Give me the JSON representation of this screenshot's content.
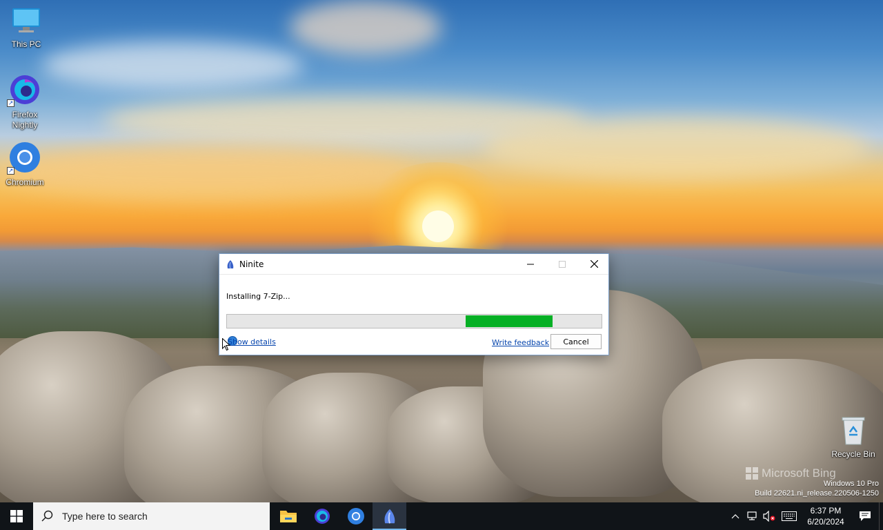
{
  "desktop": {
    "icons": [
      {
        "label": "This PC",
        "icon": "this-pc-icon"
      },
      {
        "label": "Firefox Nightly",
        "icon": "firefox-nightly-icon"
      },
      {
        "label": "Chromium",
        "icon": "chromium-icon"
      },
      {
        "label": "Recycle Bin",
        "icon": "recycle-bin-icon"
      }
    ],
    "watermark": {
      "brand": "Microsoft Bing",
      "edition": "Windows 10 Pro",
      "build": "Build 22621.ni_release.220506-1250"
    }
  },
  "window": {
    "title": "Ninite",
    "status": "Installing 7-Zip...",
    "progress_segment": {
      "start": 0.638,
      "end": 0.87
    },
    "progress_color": "#06b025",
    "show_details": "Show details",
    "write_feedback": "Write feedback",
    "cancel": "Cancel"
  },
  "taskbar": {
    "search_placeholder": "Type here to search",
    "apps": [
      "file-explorer-icon",
      "firefox-nightly-icon",
      "chromium-icon",
      "ninite-icon"
    ],
    "clock": {
      "time": "6:37 PM",
      "date": "6/20/2024"
    }
  },
  "colors": {
    "accent": "#76b9ed",
    "link": "#0645ad",
    "taskbar": "#101418"
  }
}
